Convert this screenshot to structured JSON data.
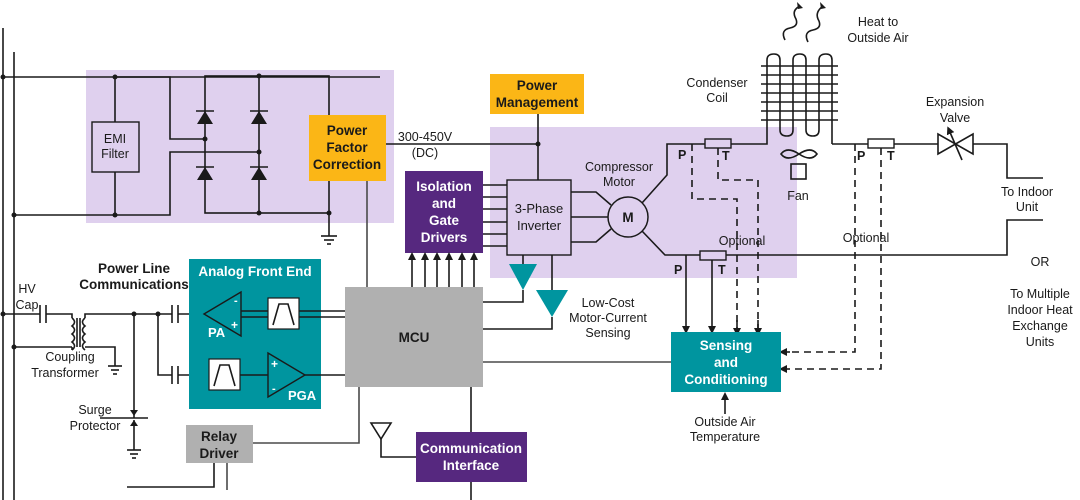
{
  "colors": {
    "lavender_region": "#dfd0ee",
    "yellow_block": "#fbb616",
    "purple_block": "#56287f",
    "teal_block": "#00959f",
    "gray_block": "#b0b0b0",
    "wire": "#1a1a1a"
  },
  "blocks": {
    "emi_filter": [
      "EMI",
      "Filter"
    ],
    "pfc": [
      "Power",
      "Factor",
      "Correction"
    ],
    "power_management": [
      "Power",
      "Management"
    ],
    "isolation_gate": [
      "Isolation",
      "and",
      "Gate",
      "Drivers"
    ],
    "inverter": [
      "3-Phase",
      "Inverter"
    ],
    "motor_symbol": "M",
    "afe_title": "Analog Front End",
    "pa": "PA",
    "pga": "PGA",
    "mcu": "MCU",
    "relay_driver": [
      "Relay",
      "Driver"
    ],
    "comm_interface": [
      "Communication",
      "Interface"
    ],
    "sensing": [
      "Sensing",
      "and",
      "Conditioning"
    ]
  },
  "labels": {
    "dc_bus": [
      "300-450V",
      "(DC)"
    ],
    "compressor_motor": [
      "Compressor",
      "Motor"
    ],
    "condenser_coil": [
      "Condenser",
      "Coil"
    ],
    "heat_out": [
      "Heat to",
      "Outside Air"
    ],
    "fan": "Fan",
    "expansion_valve": [
      "Expansion",
      "Valve"
    ],
    "to_indoor": [
      "To Indoor",
      "Unit"
    ],
    "or": "OR",
    "to_multiple": [
      "To Multiple",
      "Indoor Heat",
      "Exchange",
      "Units"
    ],
    "optional": "Optional",
    "pressure": "P",
    "temperature": "T",
    "plc": [
      "Power Line",
      "Communications"
    ],
    "hv_cap": [
      "HV",
      "Cap"
    ],
    "coupling_transformer": [
      "Coupling",
      "Transformer"
    ],
    "surge_protector": [
      "Surge",
      "Protector"
    ],
    "current_sensing": [
      "Low-Cost",
      "Motor-Current",
      "Sensing"
    ],
    "outside_air_temp": [
      "Outside Air",
      "Temperature"
    ],
    "plus": "+",
    "minus": "-"
  }
}
